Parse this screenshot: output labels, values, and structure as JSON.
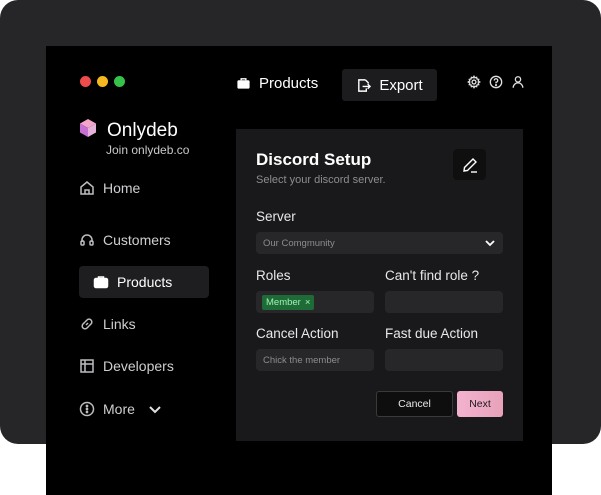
{
  "window": {
    "dots": [
      "#ee4c4a",
      "#f5b820",
      "#36c24a"
    ]
  },
  "brand": {
    "name": "Onlydeb",
    "url": "Join onlydeb.co"
  },
  "sidebar": {
    "items": [
      {
        "label": "Home",
        "icon": "home-icon"
      },
      {
        "label": "Customers",
        "icon": "headset-icon"
      },
      {
        "label": "Products",
        "icon": "briefcase-icon",
        "active": true
      },
      {
        "label": "Links",
        "icon": "link-icon"
      },
      {
        "label": "Developers",
        "icon": "grid-icon"
      },
      {
        "label": "More",
        "icon": "more-icon"
      }
    ]
  },
  "topbar": {
    "products_label": "Products",
    "export_label": "Export"
  },
  "card": {
    "title": "Discord Setup",
    "subtitle": "Select your discord server.",
    "server_label": "Server",
    "server_value": "Our Comgmunity",
    "roles_label": "Roles",
    "role_tag": "Member",
    "role_tag_remove": "×",
    "cant_find_label": "Can't find role ?",
    "cancel_action_label": "Cancel Action",
    "cancel_action_placeholder": "Chick the member",
    "fast_due_label": "Fast due Action",
    "cancel_button": "Cancel",
    "next_button": "Next"
  }
}
